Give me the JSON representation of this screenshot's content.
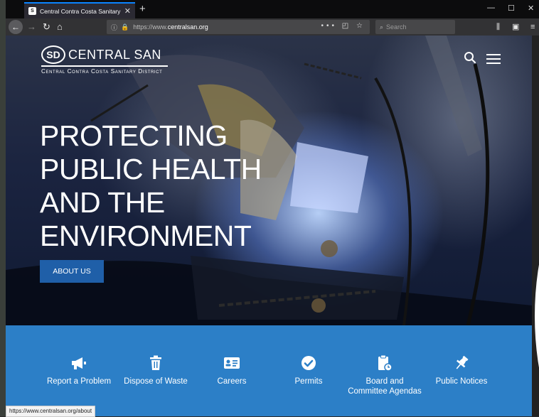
{
  "browser": {
    "tab_title": "Central Contra Costa Sanitary D",
    "url_prefix": "https://www.",
    "url_domain": "centralsan.org",
    "search_placeholder": "Search",
    "status_url": "https://www.centralsan.org/about"
  },
  "header": {
    "logo_mark": "SD",
    "logo_name": "CENTRAL SAN",
    "logo_subtitle": "Central Contra Costa Sanitary District"
  },
  "hero": {
    "headline": [
      "PROTECTING",
      "PUBLIC HEALTH",
      "AND THE",
      "ENVIRONMENT"
    ],
    "cta_label": "ABOUT US"
  },
  "tiles": [
    {
      "label": "Report a Problem",
      "icon": "megaphone-icon"
    },
    {
      "label": "Dispose of Waste",
      "icon": "trash-icon"
    },
    {
      "label": "Careers",
      "icon": "id-card-icon"
    },
    {
      "label": "Permits",
      "icon": "check-circle-icon"
    },
    {
      "label": "Board and Committee Agendas",
      "icon": "clipboard-icon"
    },
    {
      "label": "Public Notices",
      "icon": "pushpin-icon"
    }
  ],
  "colors": {
    "tile_band": "#2c7fc7",
    "cta": "#1f5fa8",
    "tab_accent": "#0a84ff"
  }
}
